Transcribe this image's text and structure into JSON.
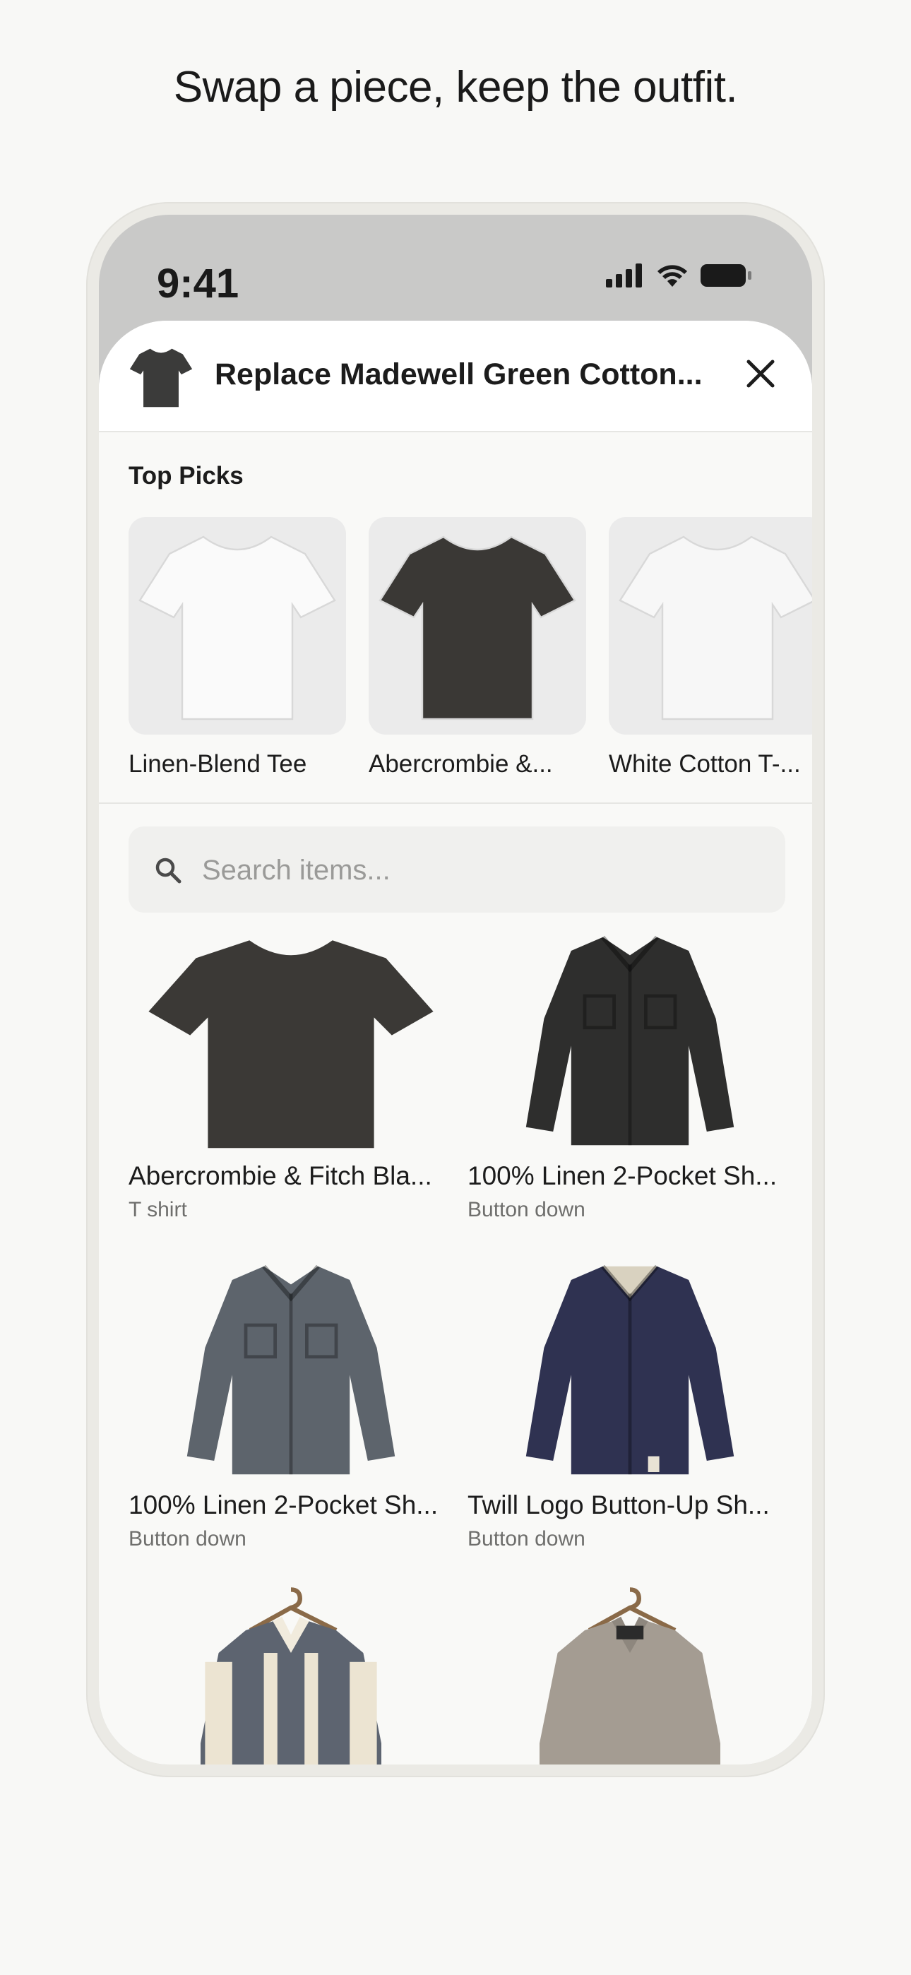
{
  "headline": "Swap a piece, keep the outfit.",
  "status_bar": {
    "time": "9:41"
  },
  "sheet": {
    "title": "Replace Madewell Green Cotton...",
    "top_picks_title": "Top Picks",
    "top_picks": [
      {
        "label": "Linen-Blend Tee",
        "color": "#fafafa"
      },
      {
        "label": "Abercrombie &...",
        "color": "#3a3835"
      },
      {
        "label": "White Cotton T-...",
        "color": "#f7f7f7"
      }
    ],
    "search": {
      "placeholder": "Search items..."
    },
    "items": [
      {
        "name": "Abercrombie & Fitch Bla...",
        "category": "T shirt",
        "color": "#3b3936"
      },
      {
        "name": "100% Linen 2-Pocket Sh...",
        "category": "Button down",
        "color": "#2e2e2d"
      },
      {
        "name": "100% Linen 2-Pocket Sh...",
        "category": "Button down",
        "color": "#5d646c"
      },
      {
        "name": "Twill Logo Button-Up Sh...",
        "category": "Button down",
        "color": "#2f3251"
      },
      {
        "name": "",
        "category": "",
        "color": "#5d6470"
      },
      {
        "name": "",
        "category": "",
        "color": "#a49c92"
      }
    ]
  },
  "colors": {
    "background": "#f8f8f6",
    "sheet": "#f9f9f7",
    "status_area": "#c9c9c8"
  }
}
